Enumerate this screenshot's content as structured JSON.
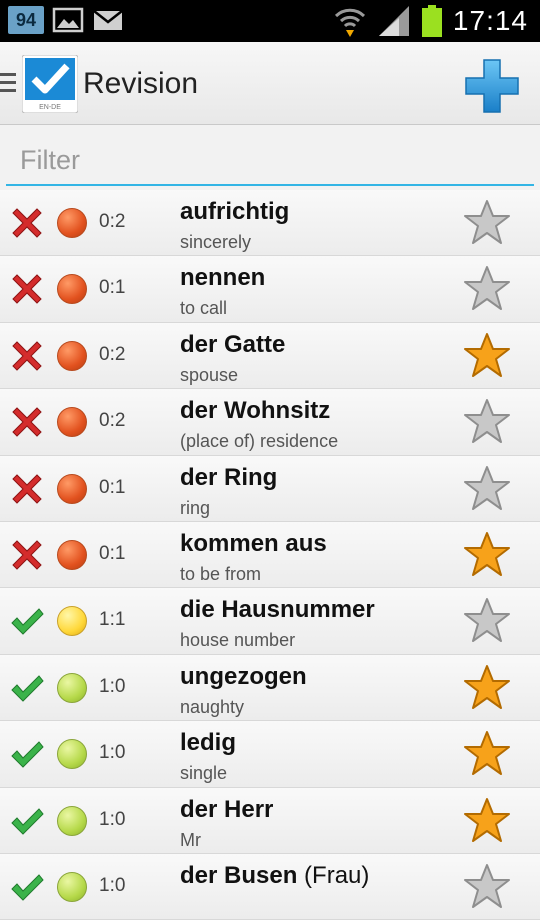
{
  "status_bar": {
    "notification_badge": "94",
    "time": "17:14",
    "icons": [
      "gallery-icon",
      "mail-icon",
      "wifi-icon",
      "signal-icon",
      "battery-icon"
    ]
  },
  "action_bar": {
    "title": "Revision",
    "logo_caption": "EN-DE"
  },
  "filter": {
    "placeholder": "Filter",
    "value": ""
  },
  "colors": {
    "accent": "#33b5e5",
    "wrong": "#d42c2c",
    "right": "#3bb34a",
    "dot_red": "#e2521f",
    "dot_yellow": "#ffd83a",
    "dot_green": "#b6d94a",
    "star_gold": "#f7a21a",
    "star_gray": "#c8c8c8"
  },
  "items": [
    {
      "word": "aufrichtig",
      "word_extra": "",
      "translation": "sincerely",
      "result": "wrong",
      "level": "red",
      "score": "0:2",
      "starred": false
    },
    {
      "word": "nennen",
      "word_extra": "",
      "translation": "to call",
      "result": "wrong",
      "level": "red",
      "score": "0:1",
      "starred": false
    },
    {
      "word": "der Gatte",
      "word_extra": "",
      "translation": "spouse",
      "result": "wrong",
      "level": "red",
      "score": "0:2",
      "starred": true
    },
    {
      "word": "der Wohnsitz",
      "word_extra": "",
      "translation": "(place of) residence",
      "result": "wrong",
      "level": "red",
      "score": "0:2",
      "starred": false
    },
    {
      "word": "der Ring",
      "word_extra": "",
      "translation": "ring",
      "result": "wrong",
      "level": "red",
      "score": "0:1",
      "starred": false
    },
    {
      "word": "kommen aus",
      "word_extra": "",
      "translation": "to be from",
      "result": "wrong",
      "level": "red",
      "score": "0:1",
      "starred": true
    },
    {
      "word": "die Hausnummer",
      "word_extra": "",
      "translation": "house number",
      "result": "right",
      "level": "yellow",
      "score": "1:1",
      "starred": false
    },
    {
      "word": "ungezogen",
      "word_extra": "",
      "translation": "naughty",
      "result": "right",
      "level": "green",
      "score": "1:0",
      "starred": true
    },
    {
      "word": "ledig",
      "word_extra": "",
      "translation": "single",
      "result": "right",
      "level": "green",
      "score": "1:0",
      "starred": true
    },
    {
      "word": "der Herr",
      "word_extra": "",
      "translation": "Mr",
      "result": "right",
      "level": "green",
      "score": "1:0",
      "starred": true
    },
    {
      "word": "der Busen",
      "word_extra": " (Frau)",
      "translation": "",
      "result": "right",
      "level": "green",
      "score": "1:0",
      "starred": false
    }
  ]
}
